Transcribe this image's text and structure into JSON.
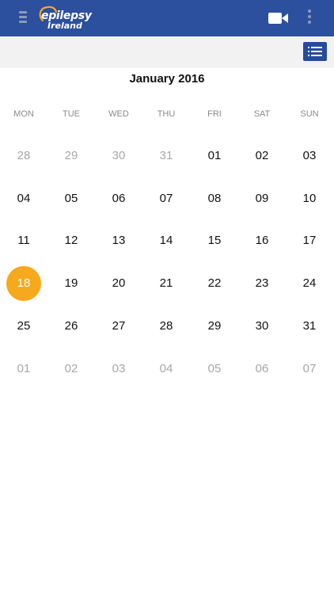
{
  "header": {
    "logo_line1": "epilepsy",
    "logo_line2": "Ireland",
    "icons": {
      "menu": "hamburger-icon",
      "video": "video-camera-icon",
      "more": "more-vert-icon",
      "list": "list-view-icon"
    },
    "colors": {
      "bar": "#2c4f9e",
      "accent": "#f7a91d"
    }
  },
  "calendar": {
    "title": "January 2016",
    "weekdays": [
      "MON",
      "TUE",
      "WED",
      "THU",
      "FRI",
      "SAT",
      "SUN"
    ],
    "weeks": [
      [
        {
          "d": "28",
          "o": true
        },
        {
          "d": "29",
          "o": true
        },
        {
          "d": "30",
          "o": true
        },
        {
          "d": "31",
          "o": true
        },
        {
          "d": "01"
        },
        {
          "d": "02"
        },
        {
          "d": "03"
        }
      ],
      [
        {
          "d": "04"
        },
        {
          "d": "05"
        },
        {
          "d": "06"
        },
        {
          "d": "07"
        },
        {
          "d": "08"
        },
        {
          "d": "09"
        },
        {
          "d": "10"
        }
      ],
      [
        {
          "d": "11"
        },
        {
          "d": "12"
        },
        {
          "d": "13"
        },
        {
          "d": "14"
        },
        {
          "d": "15"
        },
        {
          "d": "16"
        },
        {
          "d": "17"
        }
      ],
      [
        {
          "d": "18",
          "s": true
        },
        {
          "d": "19"
        },
        {
          "d": "20"
        },
        {
          "d": "21"
        },
        {
          "d": "22"
        },
        {
          "d": "23"
        },
        {
          "d": "24"
        }
      ],
      [
        {
          "d": "25"
        },
        {
          "d": "26"
        },
        {
          "d": "27"
        },
        {
          "d": "28"
        },
        {
          "d": "29"
        },
        {
          "d": "30"
        },
        {
          "d": "31"
        }
      ],
      [
        {
          "d": "01",
          "o": true
        },
        {
          "d": "02",
          "o": true
        },
        {
          "d": "03",
          "o": true
        },
        {
          "d": "04",
          "o": true
        },
        {
          "d": "05",
          "o": true
        },
        {
          "d": "06",
          "o": true
        },
        {
          "d": "07",
          "o": true
        }
      ]
    ]
  }
}
